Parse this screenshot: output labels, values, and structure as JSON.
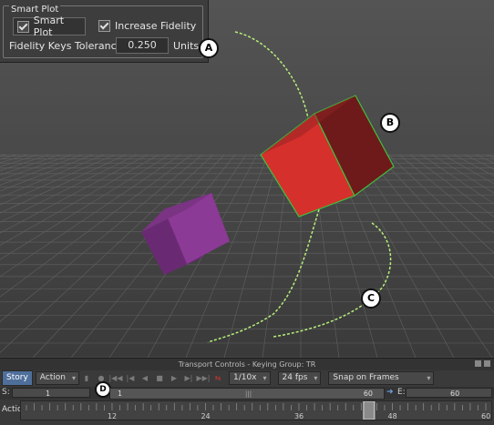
{
  "smart_plot": {
    "title": "Smart Plot",
    "smart_plot_label": "Smart Plot",
    "smart_plot_checked": true,
    "increase_fidelity_label": "Increase Fidelity",
    "increase_fidelity_checked": true,
    "tolerance_label": "Fidelity Keys Tolerance",
    "tolerance_value": "0.250",
    "units_label": "Units"
  },
  "callouts": {
    "a": "A",
    "b": "B",
    "c": "C",
    "d": "D"
  },
  "transport": {
    "title": "Transport Controls  -  Keying Group: TR",
    "story_label": "Story",
    "mode_value": "Action",
    "speed_value": "1/10x",
    "fps_value": "24 fps",
    "snap_value": "Snap on Frames",
    "start_label": "S:",
    "start_value": "1",
    "range_start": "1",
    "range_end": "60",
    "end_label": "E:",
    "end_value": "60",
    "action_label": "Action",
    "ruler_labels": [
      "12",
      "24",
      "36",
      "48",
      "60"
    ]
  },
  "colors": {
    "accent": "#4f6f9b",
    "trajectory": "#b8f07a",
    "selection": "#3fbf3f",
    "red_cube": "#d6302c",
    "purple_cube": "#8b3a95"
  }
}
